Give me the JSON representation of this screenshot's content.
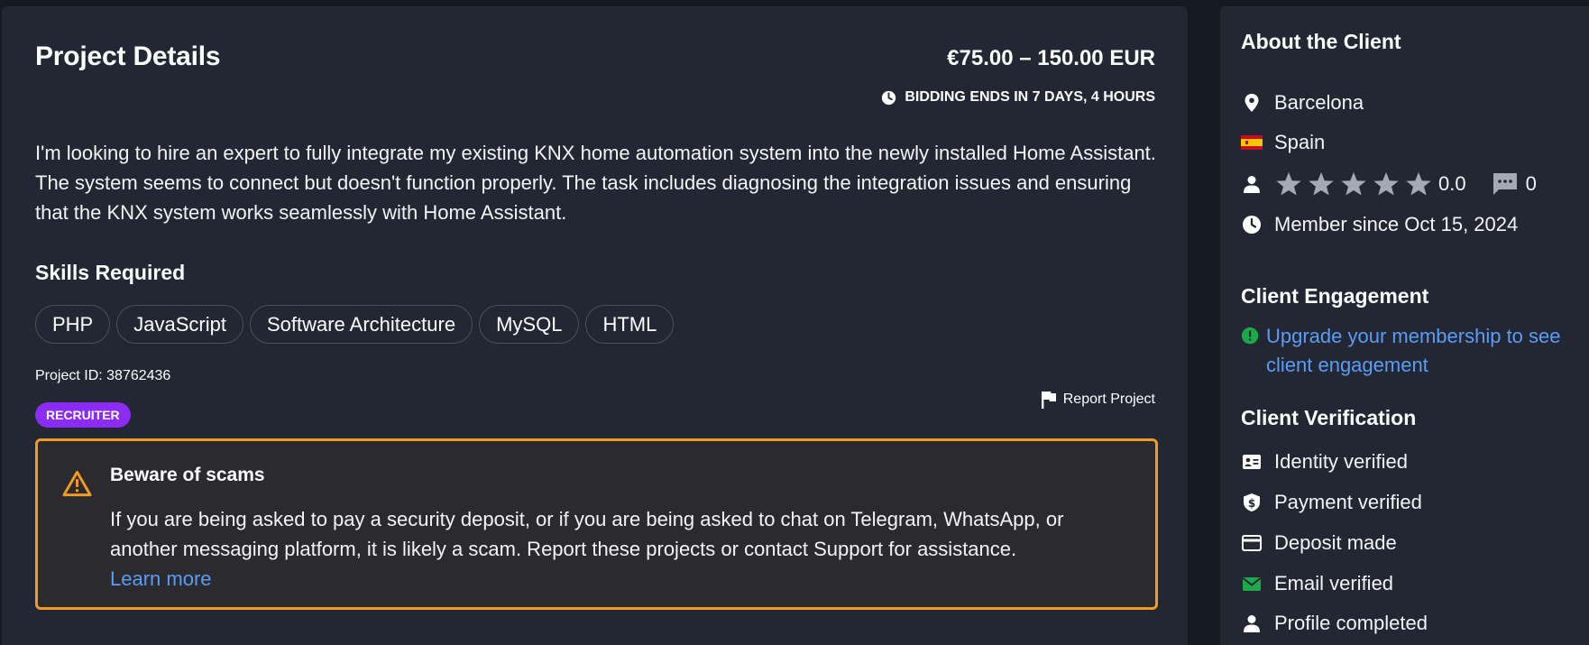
{
  "project": {
    "title": "Project Details",
    "budget": "€75.00 – 150.00 EUR",
    "bidding": "BIDDING ENDS IN 7 DAYS, 4 HOURS",
    "description": "I'm looking to hire an expert to fully integrate my existing KNX home automation system into the newly installed Home Assistant. The system seems to connect but doesn't function properly. The task includes diagnosing the integration issues and ensuring that the KNX system works seamlessly with Home Assistant.",
    "skills_title": "Skills Required",
    "skills": [
      "PHP",
      "JavaScript",
      "Software Architecture",
      "MySQL",
      "HTML"
    ],
    "project_id": "Project ID: 38762436",
    "badge": "RECRUITER",
    "report_label": "Report Project"
  },
  "scam": {
    "title": "Beware of scams",
    "text": "If you are being asked to pay a security deposit, or if you are being asked to chat on Telegram, WhatsApp, or another messaging platform, it is likely a scam. Report these projects or contact Support for assistance.",
    "learn_more": "Learn more"
  },
  "client": {
    "heading": "About the Client",
    "city": "Barcelona",
    "country": "Spain",
    "rating": "0.0",
    "reviews": "0",
    "member_since": "Member since Oct 15, 2024",
    "engagement_heading": "Client Engagement",
    "engagement_link": "Upgrade your membership to see client engagement",
    "verification_heading": "Client Verification",
    "verifications": [
      "Identity verified",
      "Payment verified",
      "Deposit made",
      "Email verified",
      "Profile completed"
    ]
  },
  "icons": [
    "clock-icon",
    "flag-icon",
    "warning-icon",
    "location-icon",
    "spain-flag-icon",
    "user-icon",
    "star-icon",
    "chat-icon",
    "info-icon",
    "id-card-icon",
    "shield-dollar-icon",
    "credit-card-icon",
    "envelope-icon"
  ],
  "colors": {
    "background": "#151922",
    "card": "#222733",
    "link": "#5b9cf5",
    "badge": "#8b2cf5",
    "warning_border": "#f29b24",
    "success": "#1fa84a"
  }
}
